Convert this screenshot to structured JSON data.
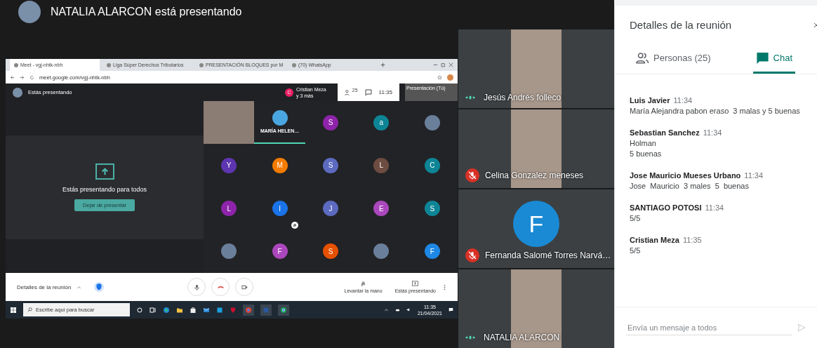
{
  "presenter_banner": {
    "text": "NATALIA ALARCON está presentando"
  },
  "shared_screen": {
    "browser_tabs": [
      {
        "label": "Meet - vgj-nhtk-nbh",
        "selected": true
      },
      {
        "label": "Liga Súper Derechos Tributarios",
        "selected": false
      },
      {
        "label": "PRESENTACIÓN BLOQUES por M",
        "selected": false
      },
      {
        "label": "(70) WhatsApp",
        "selected": false
      }
    ],
    "address": "meet.google.com/vgj-nhtk-nbh",
    "meet_header": {
      "title": "Estás presentando",
      "notice_letter": "C",
      "notice_name": "Cristian Meza",
      "notice_sub": "y 3 más",
      "people_count": "25",
      "time": "11:35",
      "presentation_label": "Presentación (Tú)"
    },
    "presenting_card": {
      "message": "Estás presentando para todos",
      "button": "Dejar de presentar"
    },
    "grid_tiles": [
      {
        "kind": "video",
        "hand_raised": false
      },
      {
        "kind": "named",
        "name": "MARÍA HELEN…",
        "hand_raised": false
      },
      {
        "kind": "letter",
        "letter": "S",
        "color": "#8e24aa",
        "hand_raised": false
      },
      {
        "kind": "letter",
        "letter": "a",
        "color": "#0e8596",
        "hand_raised": false
      },
      {
        "kind": "picture",
        "hand_raised": false
      },
      {
        "kind": "letter",
        "letter": "Y",
        "color": "#5e35b1",
        "hand_raised": false
      },
      {
        "kind": "letter",
        "letter": "M",
        "color": "#f57c00",
        "hand_raised": false
      },
      {
        "kind": "letter",
        "letter": "S",
        "color": "#5c6bc0",
        "hand_raised": false
      },
      {
        "kind": "letter",
        "letter": "L",
        "color": "#6d4c41",
        "hand_raised": false
      },
      {
        "kind": "letter",
        "letter": "C",
        "color": "#0e8596",
        "hand_raised": false
      },
      {
        "kind": "letter",
        "letter": "L",
        "color": "#8e24aa",
        "hand_raised": false
      },
      {
        "kind": "letter",
        "letter": "I",
        "color": "#1a73e8",
        "hand_raised": true
      },
      {
        "kind": "letter",
        "letter": "J",
        "color": "#5c6bc0",
        "hand_raised": false
      },
      {
        "kind": "letter",
        "letter": "E",
        "color": "#ab47bc",
        "hand_raised": false
      },
      {
        "kind": "letter",
        "letter": "S",
        "color": "#0e8596",
        "hand_raised": false
      },
      {
        "kind": "picture",
        "hand_raised": false
      },
      {
        "kind": "letter",
        "letter": "F",
        "color": "#ab47bc",
        "hand_raised": false
      },
      {
        "kind": "letter",
        "letter": "S",
        "color": "#e65100",
        "hand_raised": false
      },
      {
        "kind": "picture",
        "hand_raised": false
      },
      {
        "kind": "letter",
        "letter": "F",
        "color": "#1e88e5",
        "hand_raised": false
      }
    ],
    "bottom_bar": {
      "details": "Detalles de la reunión",
      "raise_hand": "Levantar la mano",
      "presenting": "Estás presentando"
    },
    "taskbar": {
      "search_placeholder": "Escribe aquí para buscar",
      "time": "11:35",
      "date": "21/04/2021"
    }
  },
  "side_tiles": [
    {
      "kind": "video",
      "name": "Jesús Andrés folleco",
      "muted": false
    },
    {
      "kind": "video",
      "name": "Celina Gonzalez meneses",
      "muted": true
    },
    {
      "kind": "letter",
      "letter": "F",
      "color": "#1a8ad4",
      "name": "Fernanda Salomé Torres Narvá…",
      "muted": true
    },
    {
      "kind": "video",
      "name": "NATALIA ALARCON",
      "muted": false
    }
  ],
  "details_panel": {
    "title": "Detalles de la reunión",
    "tabs": [
      {
        "kind": "people",
        "label": "Personas (25)",
        "selected": false
      },
      {
        "kind": "chat",
        "label": "Chat",
        "selected": true
      }
    ],
    "messages": [
      {
        "sender": "Luis Javier",
        "time": "11:34",
        "lines": [
          "María Alejandra pabon eraso  3 malas y 5 buenas"
        ]
      },
      {
        "sender": "Sebastian Sanchez",
        "time": "11:34",
        "lines": [
          "Holman",
          "5 buenas"
        ]
      },
      {
        "sender": "Jose Mauricio Mueses Urbano",
        "time": "11:34",
        "lines": [
          "Jose  Mauricio  3 males  5  buenas"
        ]
      },
      {
        "sender": "SANTIAGO POTOSI",
        "time": "11:34",
        "lines": [
          "5/5"
        ]
      },
      {
        "sender": "Cristian Meza",
        "time": "11:35",
        "lines": [
          "5/5"
        ]
      }
    ],
    "input_placeholder": "Envía un mensaje a todos"
  }
}
